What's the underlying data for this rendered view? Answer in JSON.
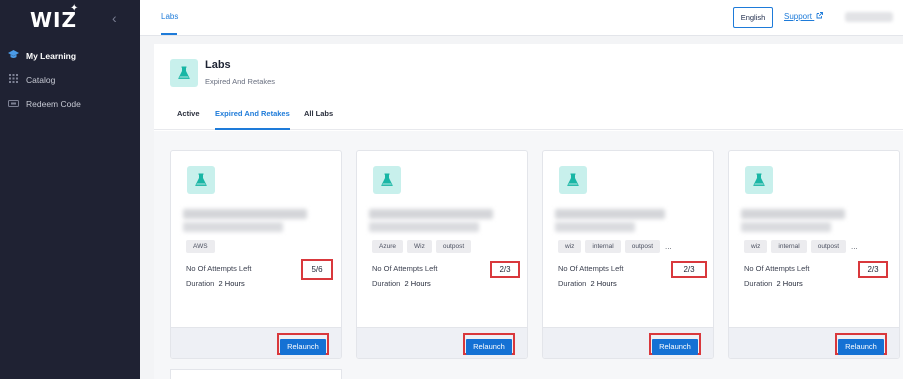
{
  "app": {
    "logo": "WIZ",
    "logo_star": "✦",
    "collapse_icon": "chevron-left-icon"
  },
  "sidebar": {
    "items": [
      {
        "label": "My Learning",
        "icon": "graduation-cap-icon",
        "active": true
      },
      {
        "label": "Catalog",
        "icon": "grid-icon",
        "active": false
      },
      {
        "label": "Redeem Code",
        "icon": "ticket-icon",
        "active": false
      }
    ]
  },
  "topbar": {
    "tab": "Labs",
    "language_button": "English",
    "support_link": "Support",
    "support_icon": "external-link-icon"
  },
  "page": {
    "title": "Labs",
    "subtitle": "Expired And Retakes",
    "icon": "flask-icon",
    "tabs": [
      {
        "label": "Active",
        "selected": false
      },
      {
        "label": "Expired And Retakes",
        "selected": true
      },
      {
        "label": "All Labs",
        "selected": false
      }
    ]
  },
  "labels": {
    "attempts": "No Of Attempts Left",
    "duration": "Duration",
    "relaunch": "Relaunch"
  },
  "cards": [
    {
      "tags": [
        "AWS"
      ],
      "more": "",
      "attempts": "5/6",
      "duration": "2 Hours"
    },
    {
      "tags": [
        "Azure",
        "Wiz",
        "outpost"
      ],
      "more": "",
      "attempts": "2/3",
      "duration": "2 Hours"
    },
    {
      "tags": [
        "wiz",
        "internal",
        "outpost"
      ],
      "more": "...",
      "attempts": "2/3",
      "duration": "2 Hours"
    },
    {
      "tags": [
        "wiz",
        "internal",
        "outpost"
      ],
      "more": "...",
      "attempts": "2/3",
      "duration": "2 Hours"
    }
  ],
  "colors": {
    "accent": "#1e7bd9",
    "sidebar": "#1f2233",
    "highlight": "#d9383c",
    "button": "#1471d4"
  }
}
